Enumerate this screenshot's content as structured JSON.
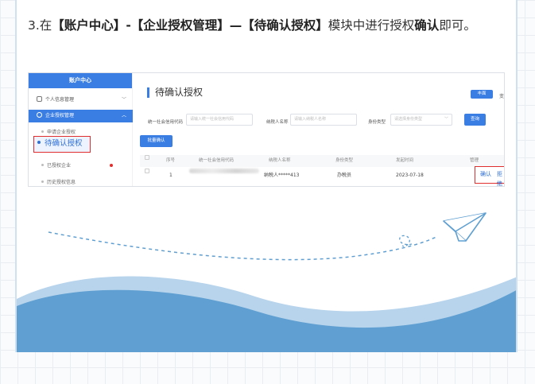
{
  "instruction": {
    "prefix": "3.在",
    "b1": "【账户中心】",
    "dash1": "-",
    "b2": "【企业授权管理】",
    "dash2": "—",
    "b3": "【待确认授权】",
    "mid": "模块中进行授权",
    "b4": "确认",
    "suffix": "即可。"
  },
  "sidebar": {
    "header": "账户中心",
    "items": [
      {
        "label": "个人信息管理",
        "chev": "﹀"
      },
      {
        "label": "企业授权管理",
        "chev": "︿"
      }
    ],
    "subitems": [
      "申请企业授权",
      "待确认授权",
      "已授权企业",
      "历史授权信息"
    ]
  },
  "main": {
    "title": "待确认授权",
    "tab_button": "丰面",
    "tab_cut": "变",
    "filters": [
      {
        "label": "统一社会信用代码",
        "placeholder": "请输入统一社会信用代码"
      },
      {
        "label": "纳税人名称",
        "placeholder": "请输入纳税人名称"
      },
      {
        "label": "身份类型",
        "placeholder": "请选择身份类型"
      }
    ],
    "search_button": "查询",
    "batch_button": "批量确认",
    "columns": [
      "序号",
      "统一社会信用代码",
      "纳税人名称",
      "身份类型",
      "发起时间",
      "管理"
    ],
    "rows": [
      {
        "index": "1",
        "taxpayer": "纳税人*****413",
        "identity": "办税员",
        "date": "2023-07-18",
        "confirm": "确认",
        "reject": "拒绝"
      }
    ]
  },
  "colors": {
    "primary": "#3a7ee4",
    "highlight": "#e02e2e",
    "wave": "#5f9fd1"
  }
}
